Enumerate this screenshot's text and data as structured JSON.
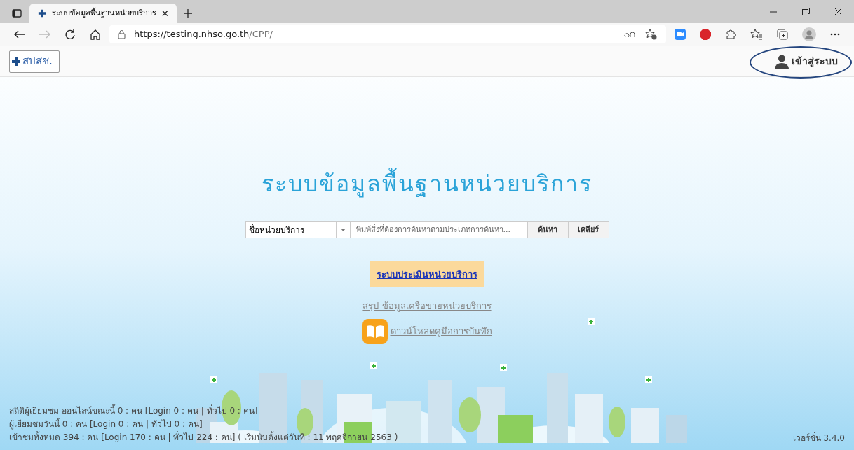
{
  "browser": {
    "tab": {
      "title": "ระบบข้อมูลพื้นฐานหน่วยบริการ",
      "selected": true
    },
    "url": {
      "host": "https://testing.nhso.go.th",
      "path": "/CPP/"
    }
  },
  "header": {
    "logo_text": "สปสช.",
    "login": "เข้าสู่ระบบ"
  },
  "main": {
    "title": "ระบบข้อมูลพื้นฐานหน่วยบริการ",
    "search": {
      "category": "ชื่อหน่วยบริการ",
      "placeholder": "พิมพ์สิ่งที่ต้องการค้นหาตามประเภทการค้นหา...",
      "buttons": [
        "ค้นหา",
        "เคลียร์"
      ]
    },
    "highlight_link": "ระบบประเมินหน่วยบริการ",
    "summary_link": "สรุป ข้อมูลเครือข่ายหน่วยบริการ",
    "download_link": "ดาวน์โหลดคู่มือการบันทึก"
  },
  "footer": {
    "stats": [
      "สถิติผู้เยียมชม ออนไลน์ขณะนี้ 0 : คน [Login 0 : คน | ทั่วไป 0 : คน]",
      "ผู้เยียมชมวันนี้ 0 : คน [Login 0 : คน | ทั่วไป 0 : คน]",
      "เข้าชมทั้งหมด 394 : คน [Login 170 : คน | ทั่วไป 224 : คน] ( เริ่มนับตั้งแต่วันที่ : 11 พฤศจิกายน 2563 )"
    ],
    "version": "เวอร์ชั่น 3.4.0"
  }
}
